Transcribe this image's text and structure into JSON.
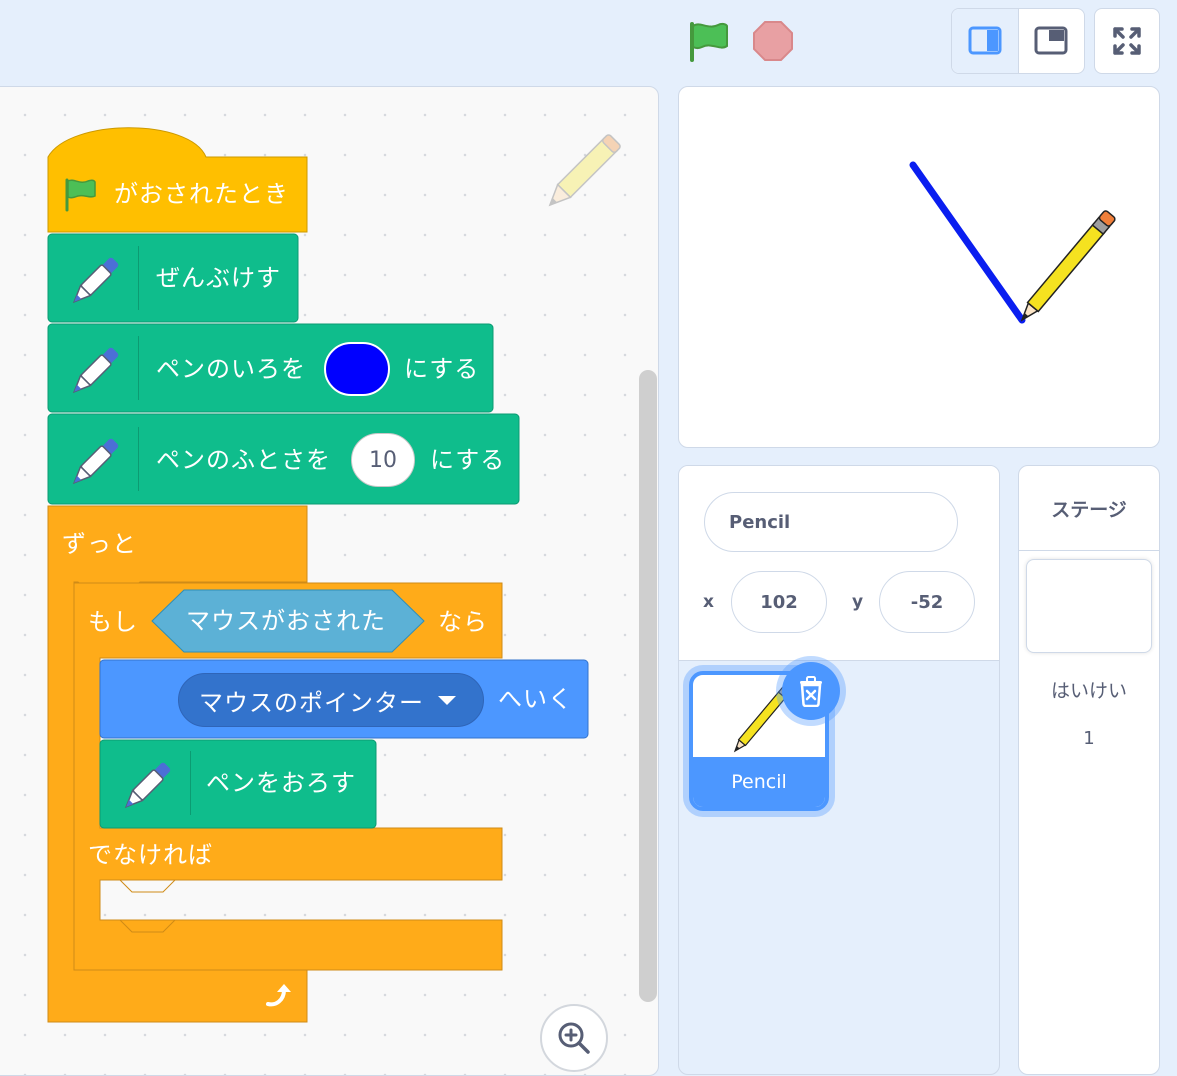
{
  "colors": {
    "events": "#ffbf00",
    "pen": "#0fbd8c",
    "control": "#ffab19",
    "sensing": "#5cb1d6",
    "motion": "#4c97ff",
    "pen_color_value": "#0000ff",
    "stage_line": "#0a1ef0"
  },
  "toolbar": {
    "green_flag_icon": "green-flag-icon",
    "stop_icon": "stop-sign-icon",
    "small_stage_icon": "small-stage-layout-icon",
    "large_stage_icon": "large-stage-layout-icon",
    "fullscreen_icon": "fullscreen-icon"
  },
  "script": {
    "hat": "がおされたとき",
    "clear": "ぜんぶけす",
    "set_color_prefix": "ペンのいろを",
    "set_color_suffix": "にする",
    "set_size_prefix": "ペンのふとさを",
    "set_size_value": "10",
    "set_size_suffix": "にする",
    "forever": "ずっと",
    "if_label": "もし",
    "condition": "マウスがおされた",
    "then_label": "なら",
    "goto_menu": "マウスのポインター",
    "goto_suffix": "へいく",
    "pen_down": "ペンをおろす",
    "else_label": "でなければ"
  },
  "sprite_info": {
    "name": "Pencil",
    "x_label": "x",
    "x_value": "102",
    "y_label": "y",
    "y_value": "-52"
  },
  "sprites": [
    {
      "name": "Pencil",
      "selected": true
    }
  ],
  "stage_panel": {
    "title": "ステージ",
    "backdrops_label": "はいけい",
    "backdrops_count": "1"
  }
}
